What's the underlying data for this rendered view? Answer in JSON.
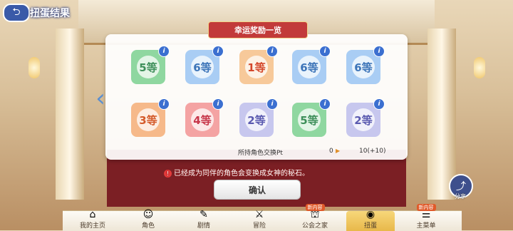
{
  "header": {
    "back_icon": "back-arrow-icon",
    "title": "扭蛋结果"
  },
  "panel": {
    "title": "幸运奖励一览",
    "tiles": [
      {
        "label": "5等",
        "color": "#8fd7a0",
        "text_color": "#3e8f5a"
      },
      {
        "label": "6等",
        "color": "#a9cdf4",
        "text_color": "#3c74b8"
      },
      {
        "label": "1等",
        "color": "#f7c99a",
        "text_color": "#d4472b"
      },
      {
        "label": "6等",
        "color": "#a9cdf4",
        "text_color": "#3c74b8"
      },
      {
        "label": "6等",
        "color": "#a9cdf4",
        "text_color": "#3c74b8"
      },
      {
        "label": "3等",
        "color": "#f6b98a",
        "text_color": "#d45a2a"
      },
      {
        "label": "4等",
        "color": "#f4a3a3",
        "text_color": "#c7364a"
      },
      {
        "label": "2等",
        "color": "#c7c7ee",
        "text_color": "#5a5ab0"
      },
      {
        "label": "5等",
        "color": "#8fd7a0",
        "text_color": "#3e8f5a"
      },
      {
        "label": "2等",
        "color": "#c7c7ee",
        "text_color": "#5a5ab0"
      }
    ],
    "info_glyph": "i",
    "exchange_label": "所持角色交换Pt",
    "exchange_value": "0",
    "exchange_arrow": "▶",
    "exchange_result": "10(+10)"
  },
  "notice": "已经成为同伴的角色会变换成女神的秘石。",
  "notice_icon": "!",
  "confirm_label": "确认",
  "share_label": "分享",
  "nav": {
    "items": [
      {
        "label": "我的主页",
        "icon": "home-icon",
        "glyph": "⌂"
      },
      {
        "label": "角色",
        "icon": "character-icon",
        "glyph": "☺"
      },
      {
        "label": "剧情",
        "icon": "story-icon",
        "glyph": "✎"
      },
      {
        "label": "冒险",
        "icon": "sword-icon",
        "glyph": "⚔"
      },
      {
        "label": "公会之家",
        "icon": "guild-house-icon",
        "glyph": "⛫",
        "tag": "新内容"
      },
      {
        "label": "扭蛋",
        "icon": "gacha-icon",
        "glyph": "◉",
        "active": true
      },
      {
        "label": "主菜单",
        "icon": "main-menu-icon",
        "glyph": "☰",
        "tag": "新内容"
      }
    ]
  }
}
